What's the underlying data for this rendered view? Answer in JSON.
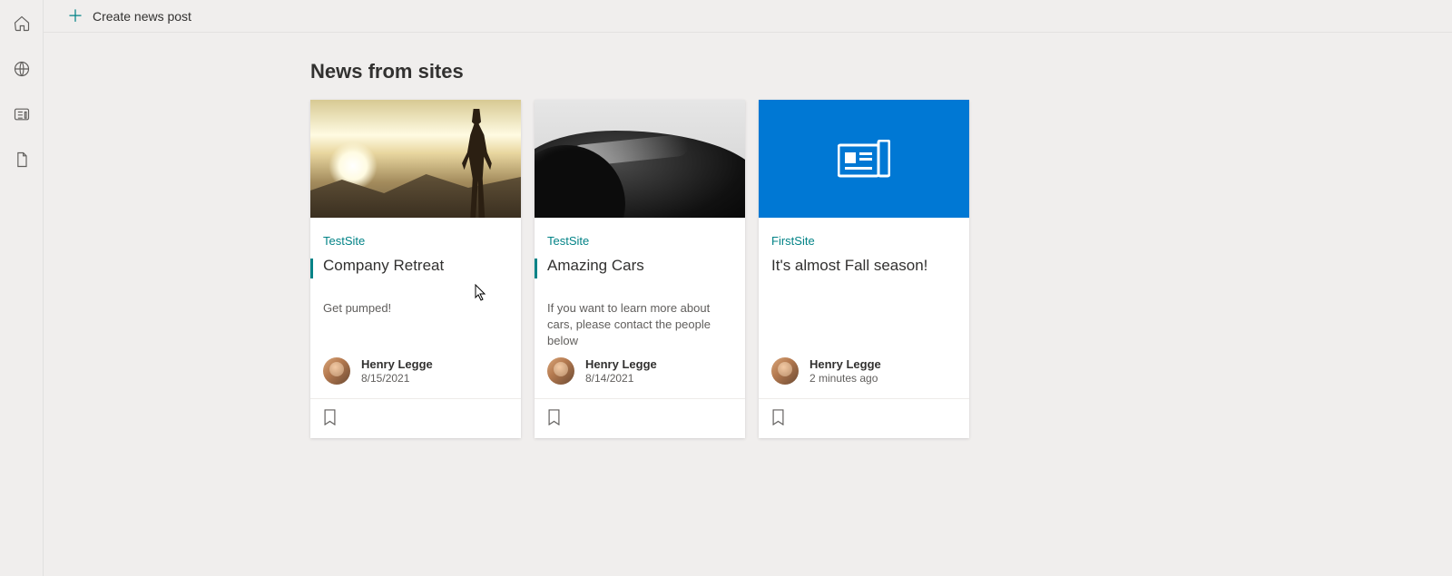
{
  "toolbar": {
    "create_label": "Create news post"
  },
  "section_title": "News from sites",
  "cards": [
    {
      "site": "TestSite",
      "title": "Company Retreat",
      "desc": "Get pumped!",
      "author": "Henry Legge",
      "date": "8/15/2021"
    },
    {
      "site": "TestSite",
      "title": "Amazing Cars",
      "desc": "If you want to learn more about cars, please contact the people below",
      "author": "Henry Legge",
      "date": "8/14/2021"
    },
    {
      "site": "FirstSite",
      "title": "It's almost Fall season!",
      "desc": "",
      "author": "Henry Legge",
      "date": "2 minutes ago"
    }
  ]
}
